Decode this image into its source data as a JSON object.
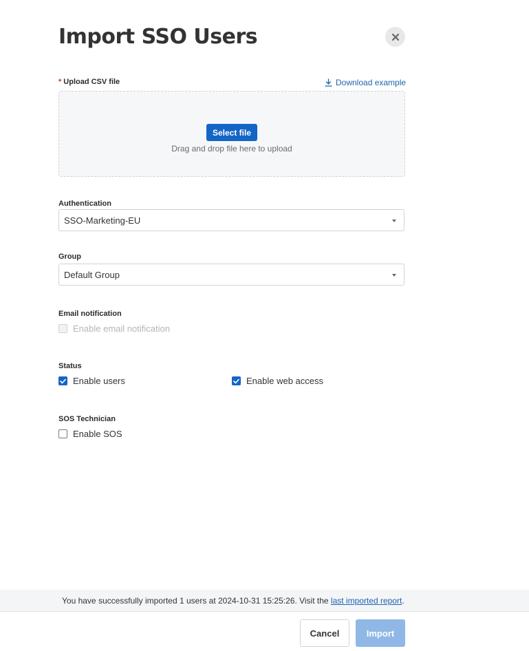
{
  "dialog": {
    "title": "Import SSO Users"
  },
  "upload": {
    "required_marker": "*",
    "label": "Upload CSV file",
    "download_example": "Download example",
    "select_file_button": "Select file",
    "drop_hint": "Drag and drop file here to upload"
  },
  "authentication": {
    "label": "Authentication",
    "selected": "SSO-Marketing-EU"
  },
  "group": {
    "label": "Group",
    "selected": "Default Group"
  },
  "email_notification": {
    "label": "Email notification",
    "checkbox_label": "Enable email notification",
    "checked": false,
    "disabled": true
  },
  "status": {
    "label": "Status",
    "enable_users": {
      "label": "Enable users",
      "checked": true
    },
    "enable_web_access": {
      "label": "Enable web access",
      "checked": true
    }
  },
  "sos": {
    "label": "SOS Technician",
    "checkbox_label": "Enable SOS",
    "checked": false
  },
  "footer": {
    "message_prefix": "You have successfully imported 1 users at 2024-10-31 15:25:26. Visit the",
    "link_text": "last imported report",
    "message_suffix": ".",
    "cancel_label": "Cancel",
    "import_label": "Import"
  },
  "colors": {
    "primary": "#1466c4",
    "link": "#1a63b0",
    "import_disabled": "#90b8e6"
  }
}
